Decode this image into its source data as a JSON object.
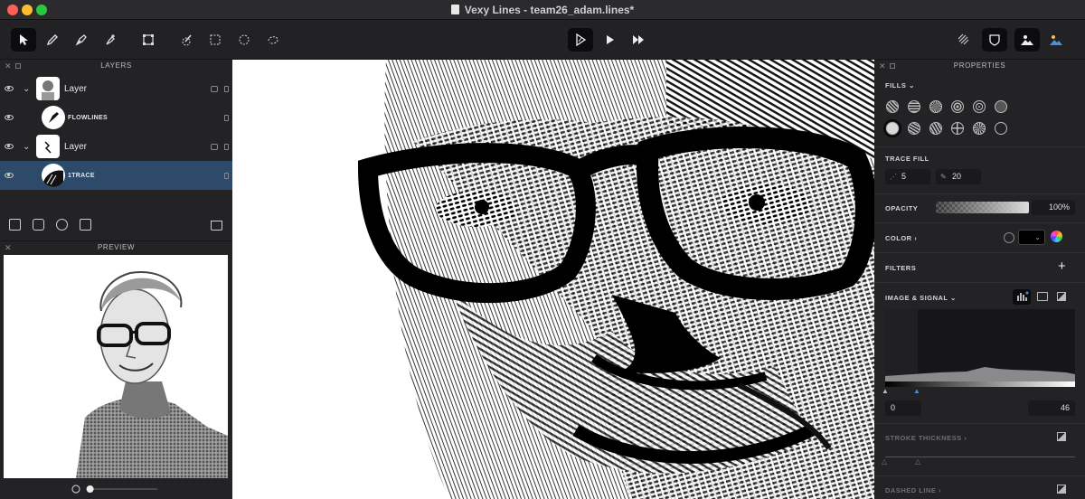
{
  "window": {
    "title": "Vexy Lines - team26_adam.lines*"
  },
  "toolbar": {
    "left_tools": [
      "select-icon",
      "pencil-icon",
      "pen-icon",
      "pen-add-icon",
      "transform-icon",
      "brush-icon",
      "rect-select-icon",
      "ellipse-select-icon",
      "lasso-icon"
    ],
    "play_tools": [
      "render-icon",
      "play-icon",
      "fast-forward-icon"
    ],
    "right_tools": [
      "mesh-icon",
      "shield-icon",
      "mountain-person-icon",
      "landscape-icon"
    ]
  },
  "layers_panel": {
    "title": "LAYERS",
    "items": [
      {
        "name": "Layer",
        "type": "group",
        "selected": false
      },
      {
        "name": "FLOWLINES",
        "type": "fill",
        "selected": false
      },
      {
        "name": "Layer",
        "type": "group",
        "selected": false
      },
      {
        "name": "1TRACE",
        "type": "fill",
        "selected": true
      }
    ]
  },
  "preview_panel": {
    "title": "PREVIEW",
    "zoom": 0.1
  },
  "properties_panel": {
    "title": "PROPERTIES",
    "fills_label": "FILLS",
    "trace_fill": {
      "label": "TRACE FILL",
      "value1": "5",
      "value2": "20"
    },
    "opacity": {
      "label": "OPACITY",
      "value": "100%"
    },
    "color_label": "COLOR",
    "filters_label": "FILTERS",
    "image_signal": {
      "label": "IMAGE & SIGNAL",
      "min": "0",
      "max": "46"
    },
    "stroke_thickness_label": "STROKE THICKNESS",
    "dashed_line_label": "DASHED LINE"
  },
  "colors": {
    "selected_row": "#2d4a6b",
    "accent": "#4a90d9"
  }
}
